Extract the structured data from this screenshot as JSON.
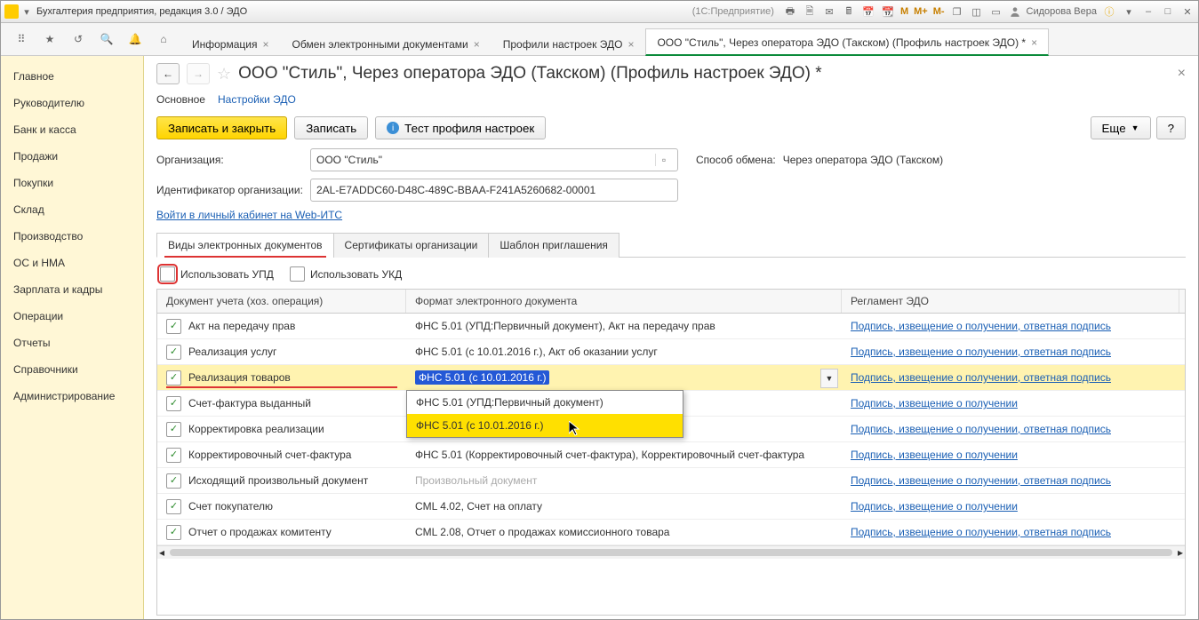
{
  "titlebar": {
    "app": "Бухгалтерия предприятия, редакция 3.0 / ЭДО",
    "mode": "(1С:Предприятие)",
    "user": "Сидорова Вера"
  },
  "toptabs": [
    {
      "label": "Информация",
      "close": true
    },
    {
      "label": "Обмен электронными документами",
      "close": true
    },
    {
      "label": "Профили настроек ЭДО",
      "close": true
    },
    {
      "label": "ООО \"Стиль\", Через оператора ЭДО (Такском) (Профиль настроек ЭДО) *",
      "close": true,
      "active": true
    }
  ],
  "sidebar": [
    "Главное",
    "Руководителю",
    "Банк и касса",
    "Продажи",
    "Покупки",
    "Склад",
    "Производство",
    "ОС и НМА",
    "Зарплата и кадры",
    "Операции",
    "Отчеты",
    "Справочники",
    "Администрирование"
  ],
  "page": {
    "title": "ООО \"Стиль\", Через оператора ЭДО (Такском) (Профиль настроек ЭДО) *",
    "subtabs": {
      "main": "Основное",
      "edo": "Настройки ЭДО"
    },
    "buttons": {
      "save_close": "Записать и закрыть",
      "save": "Записать",
      "test": "Тест профиля настроек",
      "more": "Еще",
      "help": "?"
    },
    "org_label": "Организация:",
    "org_value": "ООО \"Стиль\"",
    "method_label": "Способ обмена:",
    "method_value": "Через оператора ЭДО (Такском)",
    "id_label": "Идентификатор организации:",
    "id_value": "2AL-E7ADDC60-D48C-489C-BBAA-F241A5260682-00001",
    "cabinet_link": "Войти в личный кабинет на Web-ИТС",
    "pgtabs": {
      "docs": "Виды электронных документов",
      "certs": "Сертификаты организации",
      "invite": "Шаблон приглашения"
    },
    "chk_upd": "Использовать УПД",
    "chk_ukd": "Использовать УКД",
    "cols": {
      "doc": "Документ учета (хоз. операция)",
      "fmt": "Формат электронного документа",
      "reg": "Регламент ЭДО"
    },
    "rows": [
      {
        "doc": "Акт на передачу прав",
        "fmt": "ФНС 5.01 (УПД:Первичный документ), Акт на передачу прав",
        "reg": "Подпись, извещение о получении, ответная подпись"
      },
      {
        "doc": "Реализация услуг",
        "fmt": "ФНС 5.01 (с 10.01.2016 г.), Акт об оказании услуг",
        "reg": "Подпись, извещение о получении, ответная подпись"
      },
      {
        "doc": "Реализация товаров",
        "fmt": "ФНС 5.01 (с 10.01.2016 г.)",
        "reg": "Подпись, извещение о получении, ответная подпись",
        "selected": true
      },
      {
        "doc": "Счет-фактура выданный",
        "fmt": "ФНС 5.01 (УПД:Первичный документ)",
        "reg": "Подпись, извещение о получении",
        "dd": true
      },
      {
        "doc": "Корректировка реализации",
        "fmt": "ФНС 5.01 (с 10.01.2016 г.)",
        "reg": "Подпись, извещение о получении, ответная подпись",
        "dd_hl": true
      },
      {
        "doc": "Корректировочный счет-фактура",
        "fmt": "ФНС 5.01 (Корректировочный счет-фактура), Корректировочный счет-фактура",
        "reg": "Подпись, извещение о получении"
      },
      {
        "doc": "Исходящий произвольный документ",
        "fmt": "Произвольный документ",
        "reg": "Подпись, извещение о получении, ответная подпись",
        "gray": true
      },
      {
        "doc": "Счет покупателю",
        "fmt": "CML 4.02, Счет на оплату",
        "reg": "Подпись, извещение о получении"
      },
      {
        "doc": "Отчет о продажах комитенту",
        "fmt": "CML 2.08, Отчет о продажах комиссионного товара",
        "reg": "Подпись, извещение о получении, ответная подпись"
      }
    ],
    "dropdown": {
      "opt1": "ФНС 5.01 (УПД:Первичный документ)",
      "opt2": "ФНС 5.01 (с 10.01.2016 г.)"
    }
  }
}
